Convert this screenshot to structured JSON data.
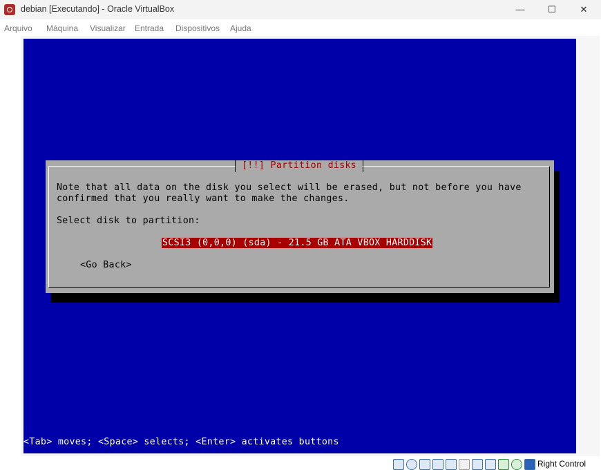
{
  "window": {
    "title": "debian [Executando] - Oracle VirtualBox",
    "minimize_glyph": "—",
    "maximize_glyph": "☐",
    "close_glyph": "✕"
  },
  "menu": {
    "items": [
      "Arquivo",
      "Máquina",
      "Visualizar",
      "Entrada",
      "Dispositivos",
      "Ajuda"
    ]
  },
  "installer": {
    "dialog_title": "[!!] Partition disks",
    "note_line1": "Note that all data on the disk you select will be erased, but not before you have",
    "note_line2": "confirmed that you really want to make the changes.",
    "select_prompt": "Select disk to partition:",
    "selected_disk": "SCSI3 (0,0,0) (sda) - 21.5 GB ATA VBOX HARDDISK",
    "go_back": "<Go Back>",
    "help_line": "<Tab> moves; <Space> selects; <Enter> activates buttons",
    "colors": {
      "screen_bg": "#0000a8",
      "dialog_bg": "#aaaaaa",
      "title_fg": "#a80000",
      "selection_bg": "#a80000"
    }
  },
  "statusbar": {
    "icons": [
      "hard-disk-icon",
      "optical-drive-icon",
      "audio-icon",
      "network-icon",
      "usb-icon",
      "shared-folders-icon",
      "display-icon",
      "recording-icon",
      "cpu-icon",
      "mouse-integration-icon",
      "keyboard-icon"
    ],
    "host_key": "Right Control"
  }
}
